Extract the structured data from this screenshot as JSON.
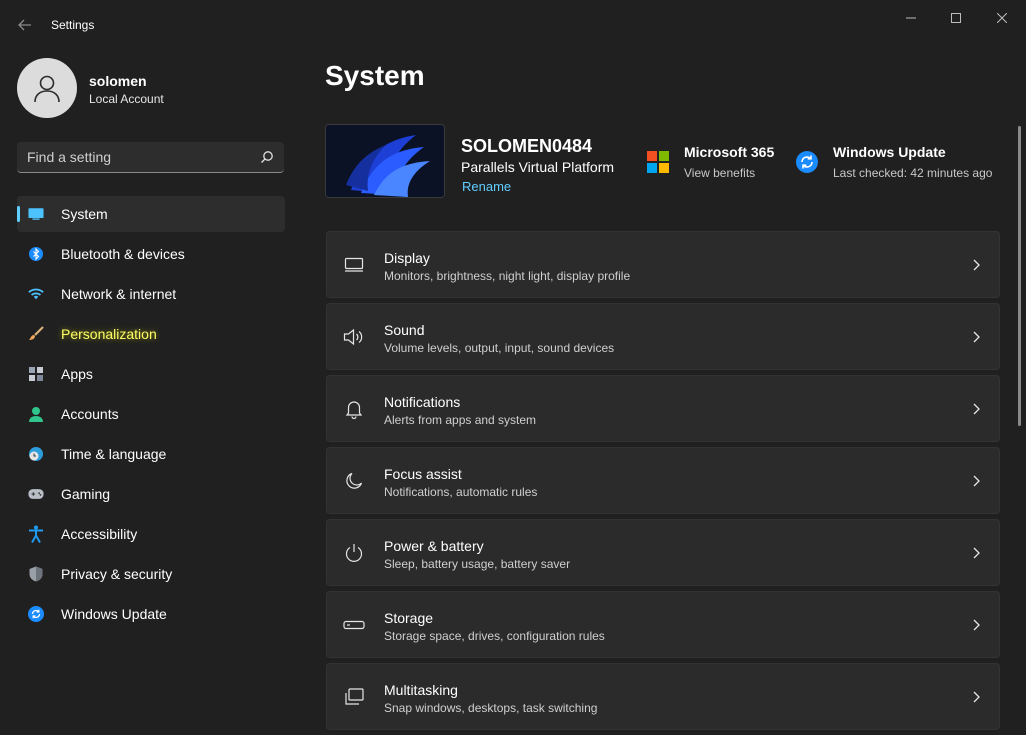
{
  "app": {
    "title": "Settings"
  },
  "profile": {
    "name": "solomen",
    "account_type": "Local Account"
  },
  "search": {
    "placeholder": "Find a setting"
  },
  "sidebar": {
    "items": [
      {
        "label": "System",
        "icon": "monitor-icon",
        "active": true
      },
      {
        "label": "Bluetooth & devices",
        "icon": "bluetooth-icon"
      },
      {
        "label": "Network & internet",
        "icon": "wifi-icon"
      },
      {
        "label": "Personalization",
        "icon": "paintbrush-icon",
        "highlighted": true
      },
      {
        "label": "Apps",
        "icon": "apps-icon"
      },
      {
        "label": "Accounts",
        "icon": "person-icon"
      },
      {
        "label": "Time & language",
        "icon": "globe-clock-icon"
      },
      {
        "label": "Gaming",
        "icon": "gamepad-icon"
      },
      {
        "label": "Accessibility",
        "icon": "accessibility-icon"
      },
      {
        "label": "Privacy & security",
        "icon": "shield-icon"
      },
      {
        "label": "Windows Update",
        "icon": "update-icon"
      }
    ]
  },
  "main": {
    "title": "System",
    "device": {
      "name": "SOLOMEN0484",
      "model": "Parallels Virtual Platform",
      "rename_label": "Rename"
    },
    "quick_links": [
      {
        "title": "Microsoft 365",
        "subtitle": "View benefits",
        "icon": "microsoft-logo-icon"
      },
      {
        "title": "Windows Update",
        "subtitle": "Last checked: 42 minutes ago",
        "icon": "update-icon"
      }
    ],
    "cards": [
      {
        "title": "Display",
        "subtitle": "Monitors, brightness, night light, display profile",
        "icon": "display-icon"
      },
      {
        "title": "Sound",
        "subtitle": "Volume levels, output, input, sound devices",
        "icon": "speaker-icon"
      },
      {
        "title": "Notifications",
        "subtitle": "Alerts from apps and system",
        "icon": "bell-icon"
      },
      {
        "title": "Focus assist",
        "subtitle": "Notifications, automatic rules",
        "icon": "moon-icon"
      },
      {
        "title": "Power & battery",
        "subtitle": "Sleep, battery usage, battery saver",
        "icon": "power-icon"
      },
      {
        "title": "Storage",
        "subtitle": "Storage space, drives, configuration rules",
        "icon": "storage-icon"
      },
      {
        "title": "Multitasking",
        "subtitle": "Snap windows, desktops, task switching",
        "icon": "multitasking-icon"
      }
    ]
  },
  "colors": {
    "background": "#202020",
    "card": "#2b2b2b",
    "accent": "#60cdff",
    "highlight": "#ffff66"
  }
}
